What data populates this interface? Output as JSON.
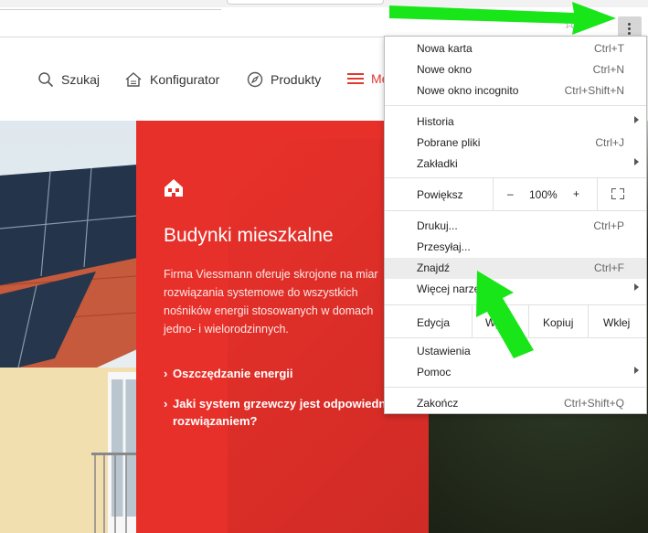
{
  "browser": {
    "star_icon": "star-icon",
    "menu_icon": "vertical-dots-icon"
  },
  "nav": {
    "items": [
      {
        "label": "Szukaj",
        "icon": "search-icon"
      },
      {
        "label": "Konfigurator",
        "icon": "house-icon"
      },
      {
        "label": "Produkty",
        "icon": "compass-icon"
      },
      {
        "label": "Me",
        "icon": "hamburger-icon"
      }
    ]
  },
  "hero": {
    "title": "Budynki mieszkalne",
    "text": "Firma Viessmann oferuje skrojone na miar rozwiązania systemowe do wszystkich nośników energii stosowanych w domach jedno- i wielorodzinnych.",
    "link1": "Oszczędzanie energii",
    "link2_line1": "Jaki system grzewczy jest odpowiedn",
    "link2_line2": "rozwiązaniem?"
  },
  "menu": {
    "new_tab": {
      "label": "Nowa karta",
      "shortcut": "Ctrl+T"
    },
    "new_window": {
      "label": "Nowe okno",
      "shortcut": "Ctrl+N"
    },
    "incognito": {
      "label": "Nowe okno incognito",
      "shortcut": "Ctrl+Shift+N"
    },
    "history": {
      "label": "Historia"
    },
    "downloads": {
      "label": "Pobrane pliki",
      "shortcut": "Ctrl+J"
    },
    "bookmarks": {
      "label": "Zakładki"
    },
    "zoom": {
      "label": "Powiększ",
      "minus": "–",
      "value": "100%",
      "plus": "+"
    },
    "print": {
      "label": "Drukuj...",
      "shortcut": "Ctrl+P"
    },
    "cast": {
      "label": "Przesyłaj..."
    },
    "find": {
      "label": "Znajdź",
      "shortcut": "Ctrl+F"
    },
    "more_tools": {
      "label": "Więcej narzę"
    },
    "edit": {
      "label": "Edycja",
      "cut": "Wy",
      "copy": "Kopiuj",
      "paste": "Wklej"
    },
    "settings": {
      "label": "Ustawienia"
    },
    "help": {
      "label": "Pomoc"
    },
    "exit": {
      "label": "Zakończ",
      "shortcut": "Ctrl+Shift+Q"
    }
  },
  "colors": {
    "accent_red": "#e8302a",
    "arrow_green": "#19e619"
  }
}
